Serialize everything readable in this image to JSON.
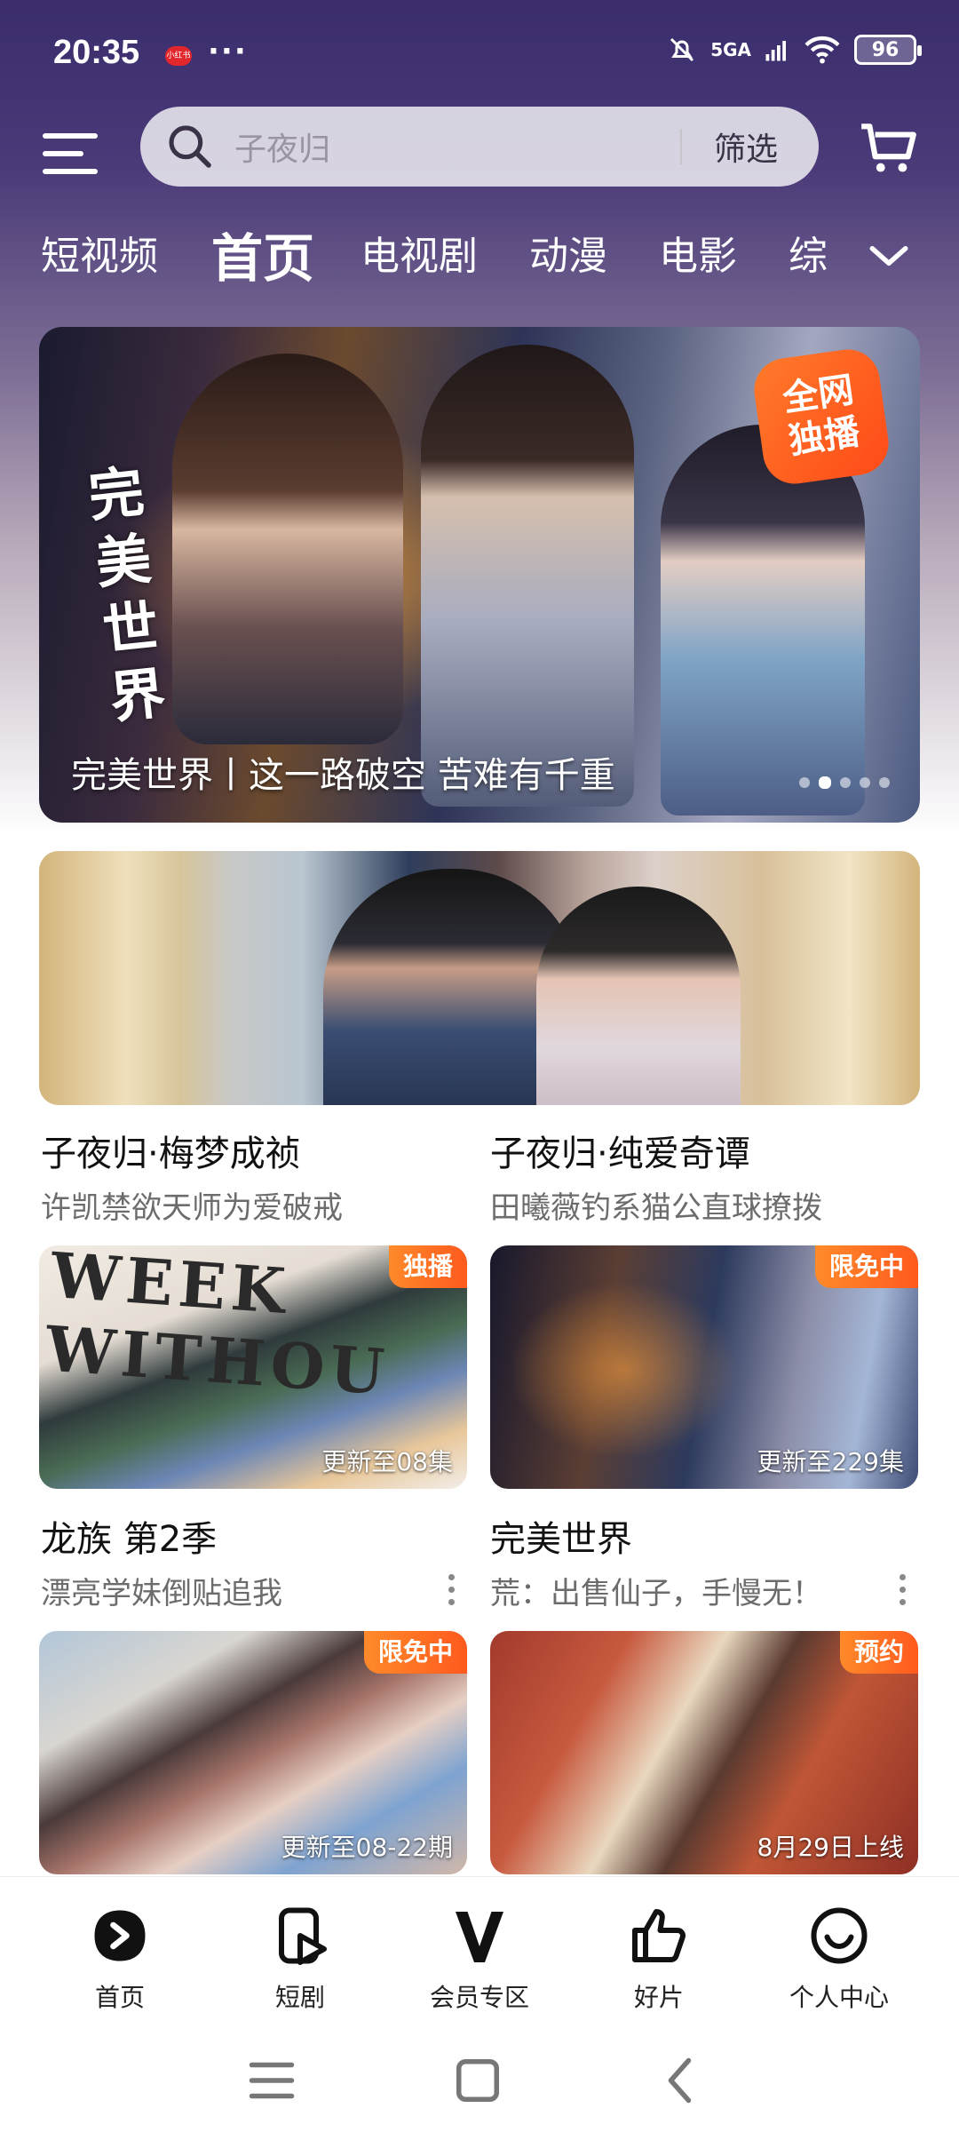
{
  "status_bar": {
    "time": "20:35",
    "app_indicator": "小红书",
    "more_dots": "···",
    "network": "5GA",
    "battery": "96"
  },
  "header": {
    "search_placeholder": "子夜归",
    "filter_label": "筛选"
  },
  "tabs": [
    "短视频",
    "首页",
    "电视剧",
    "动漫",
    "电影",
    "综"
  ],
  "active_tab": "首页",
  "banner": {
    "caption": "完美世界丨这一路破空 苦难有千重",
    "calligraphy": [
      "完",
      "美",
      "世",
      "界"
    ],
    "badge": [
      "全网",
      "独播"
    ],
    "page_count": 5,
    "active_page": 2
  },
  "feature_pair": [
    {
      "title": "子夜归·梅梦成祯",
      "subtitle": "许凯禁欲天师为爱破戒"
    },
    {
      "title": "子夜归·纯爱奇谭",
      "subtitle": "田曦薇钓系猫公直球撩拨"
    }
  ],
  "cards": [
    {
      "tag": "独播",
      "update": "更新至08集",
      "art_text": "WEEK WITHOU",
      "title": "龙族 第2季",
      "subtitle": "漂亮学妹倒贴追我"
    },
    {
      "tag": "限免中",
      "update": "更新至229集",
      "title": "完美世界",
      "subtitle": "荒：出售仙子，手慢无！"
    },
    {
      "tag": "限免中",
      "update": "更新至08-22期",
      "title": "",
      "subtitle": ""
    },
    {
      "tag": "预约",
      "update": "8月29日上线",
      "title": "",
      "subtitle": ""
    }
  ],
  "bottom_nav": [
    {
      "label": "首页",
      "icon": "play-icon"
    },
    {
      "label": "短剧",
      "icon": "short-drama-icon"
    },
    {
      "label": "会员专区",
      "icon": "vip-icon"
    },
    {
      "label": "好片",
      "icon": "thumbs-up-icon"
    },
    {
      "label": "个人中心",
      "icon": "profile-icon"
    }
  ],
  "colors": {
    "accent": "#ff5a1e",
    "header_bg": "#3b2c6c"
  }
}
